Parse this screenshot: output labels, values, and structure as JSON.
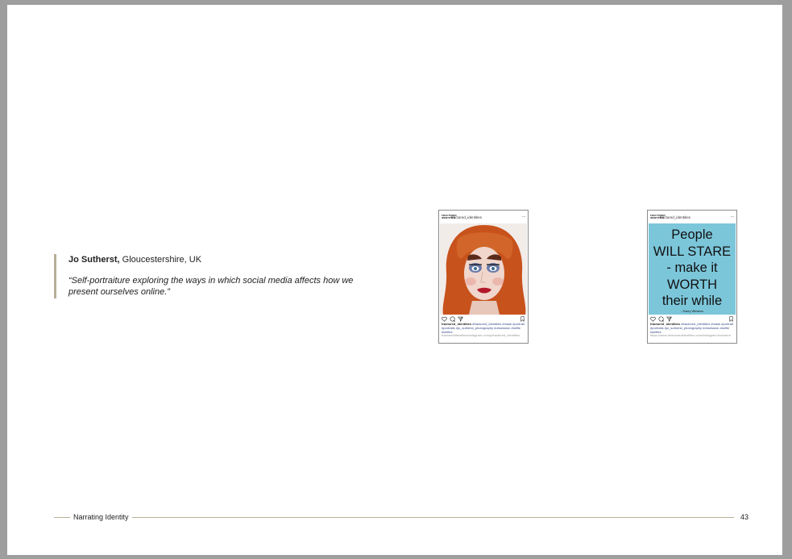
{
  "quote": {
    "author_name": "Jo Sutherst,",
    "author_location": "Gloucestershire, UK",
    "text": "“Self-portraiture exploring the ways in which social media affects how we present ourselves online.”"
  },
  "posts": [
    {
      "avatar": "FRACTURED IDENTITIES",
      "username": "fractured_identities",
      "more": "···",
      "caption_user": "fractured_identities",
      "caption_tags": "#fractured_identities #mask #portrait #portraits #jo_sutherst_photography #obsession #selfie #selfies",
      "caption_tiny": "fracturedidentities/instagram.com/p/fractured_identities"
    },
    {
      "avatar": "FRACTURED IDENTITIES",
      "username": "fractured_identities",
      "more": "···",
      "poster_lines": [
        "People",
        "WILL STARE",
        "- make it",
        "WORTH",
        "their while"
      ],
      "poster_credit": "- Harry Winston",
      "caption_user": "fractured_identities",
      "caption_tags": "#fractured_identities #mask #portrait #portraits #jo_sutherst_photography #obsession #selfie #selfies",
      "caption_tiny": "https://www.nfracturedidentities.com/instagram-fractured"
    }
  ],
  "footer": {
    "title": "Narrating Identity",
    "page_number": "43"
  },
  "colors": {
    "accent_rule": "#b9ad97",
    "poster_bg": "#7cc6da",
    "hair": "#c8521c"
  }
}
